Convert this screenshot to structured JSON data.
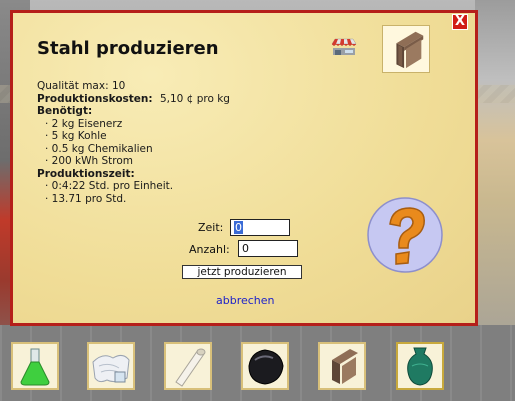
{
  "dialog": {
    "title": "Stahl produzieren",
    "close_label": "X",
    "quality": "Qualität max: 10",
    "cost_label": "Produktionskosten:",
    "cost_value": "5,10 ¢ pro kg",
    "needed_label": "Benötigt:",
    "needed_items": [
      "· 2 kg Eisenerz",
      "· 5 kg Kohle",
      "· 0.5 kg Chemikalien",
      "· 200 kWh Strom"
    ],
    "time_label": "Produktionszeit:",
    "time_items": [
      "· 0:4:22 Std. pro Einheit.",
      "· 13.71 pro Std."
    ],
    "form": {
      "zeit_label": "Zeit:",
      "zeit_value": "0",
      "anzahl_label": "Anzahl:",
      "anzahl_value": "0",
      "produce_button": "jetzt produzieren",
      "cancel_link": "abbrechen"
    }
  },
  "tiles": [
    {
      "name": "flask-icon"
    },
    {
      "name": "cloth-icon"
    },
    {
      "name": "paper-roll-icon"
    },
    {
      "name": "rubber-block-icon"
    },
    {
      "name": "steel-beam-icon"
    },
    {
      "name": "vase-icon"
    }
  ],
  "colors": {
    "dialog_border": "#b51f1a",
    "dialog_bg": "#f3e3a0",
    "link": "#1d22c9",
    "help_bubble": "#c6c8f2",
    "help_question": "#e98a1c"
  }
}
